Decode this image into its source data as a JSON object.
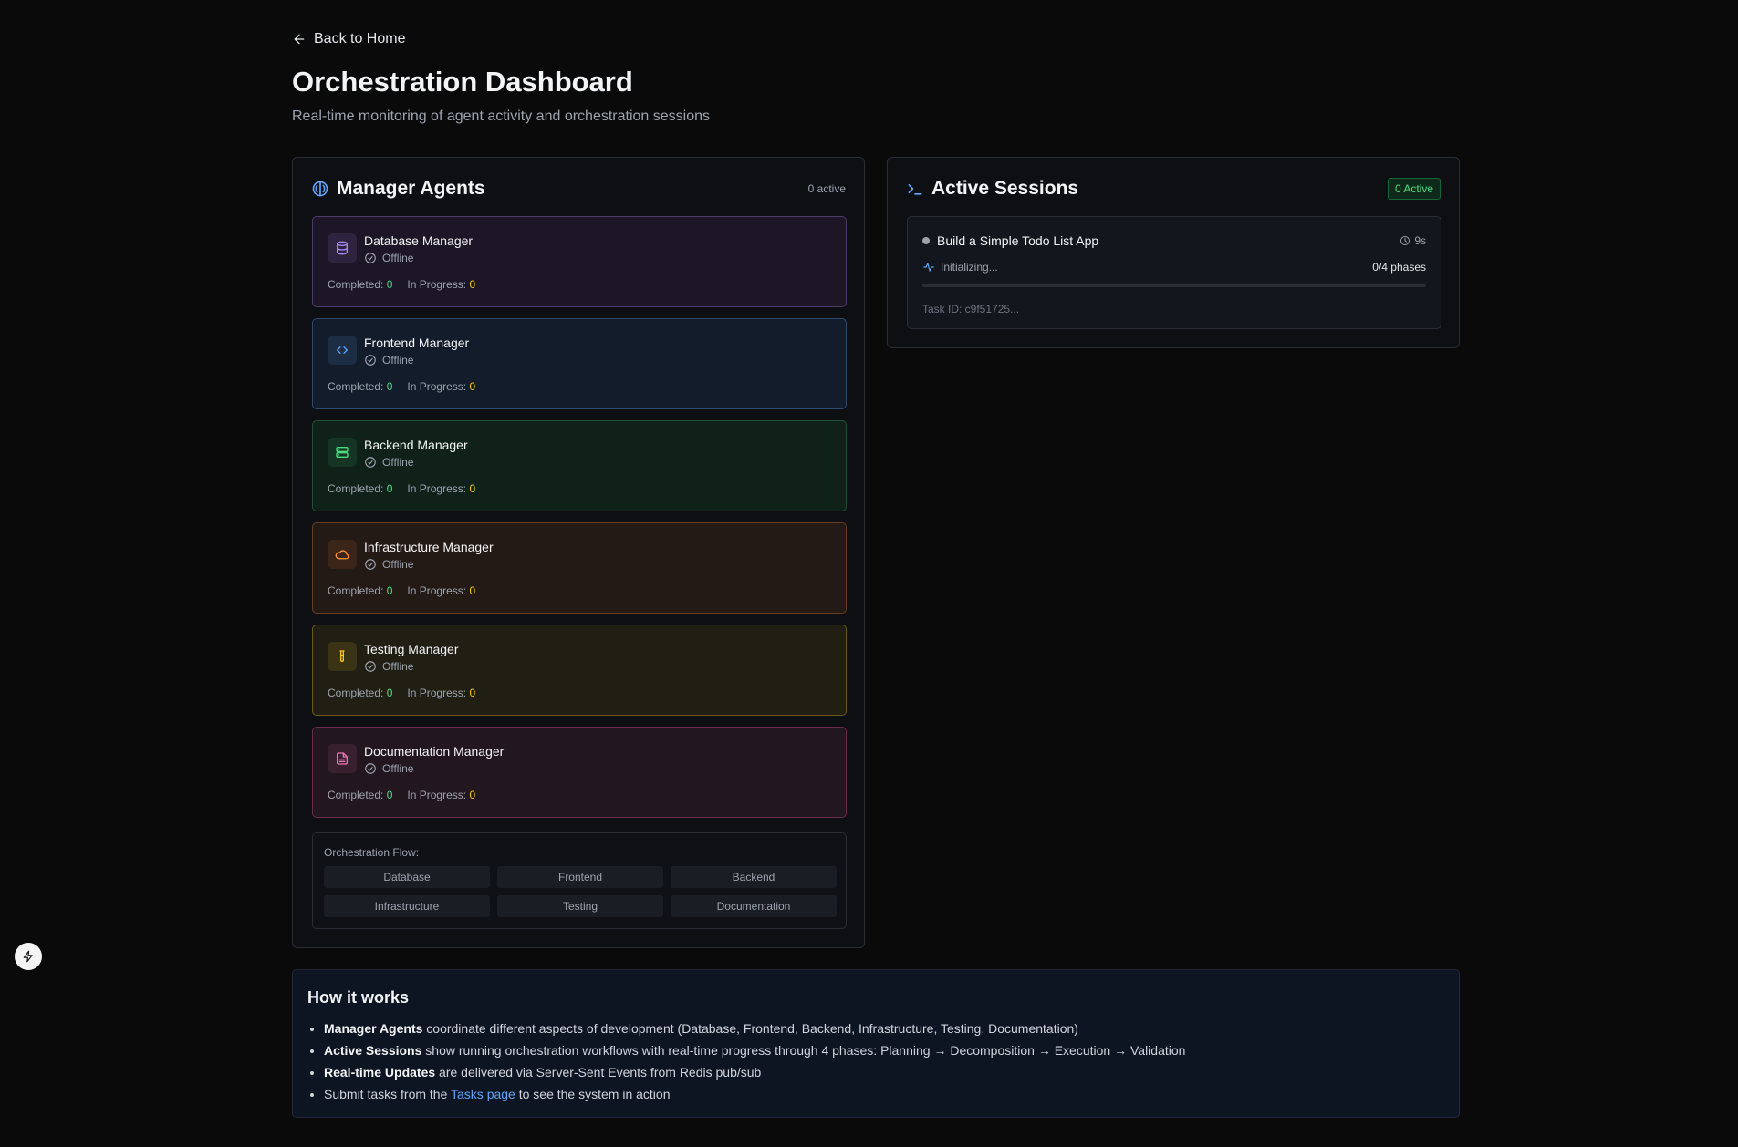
{
  "nav": {
    "back_label": "Back to Home"
  },
  "header": {
    "title": "Orchestration Dashboard",
    "subtitle": "Real-time monitoring of agent activity and orchestration sessions"
  },
  "agents_panel": {
    "title": "Manager Agents",
    "count_label": "0 active",
    "completed_label": "Completed:",
    "in_progress_label": "In Progress:",
    "agents": [
      {
        "name": "Database Manager",
        "status": "Offline",
        "completed": "0",
        "in_progress": "0",
        "icon": "database-icon",
        "color": "#a78bfa"
      },
      {
        "name": "Frontend Manager",
        "status": "Offline",
        "completed": "0",
        "in_progress": "0",
        "icon": "code-icon",
        "color": "#60a5fa"
      },
      {
        "name": "Backend Manager",
        "status": "Offline",
        "completed": "0",
        "in_progress": "0",
        "icon": "server-icon",
        "color": "#4ade80"
      },
      {
        "name": "Infrastructure Manager",
        "status": "Offline",
        "completed": "0",
        "in_progress": "0",
        "icon": "cloud-icon",
        "color": "#fb923c"
      },
      {
        "name": "Testing Manager",
        "status": "Offline",
        "completed": "0",
        "in_progress": "0",
        "icon": "test-tube-icon",
        "color": "#facc15"
      },
      {
        "name": "Documentation Manager",
        "status": "Offline",
        "completed": "0",
        "in_progress": "0",
        "icon": "file-text-icon",
        "color": "#f472b6"
      }
    ],
    "flow": {
      "label": "Orchestration Flow:",
      "steps": [
        "Database",
        "Frontend",
        "Backend",
        "Infrastructure",
        "Testing",
        "Documentation"
      ]
    }
  },
  "sessions_panel": {
    "title": "Active Sessions",
    "badge": "0 Active",
    "sessions": [
      {
        "title": "Build a Simple Todo List App",
        "elapsed": "9s",
        "state": "Initializing...",
        "phases": "0/4 phases",
        "progress": 0,
        "task_id": "Task ID: c9f51725..."
      }
    ]
  },
  "how_it_works": {
    "title": "How it works",
    "items": [
      {
        "bold": "Manager Agents",
        "text": " coordinate different aspects of development (Database, Frontend, Backend, Infrastructure, Testing, Documentation)"
      },
      {
        "bold": "Active Sessions",
        "text": " show running orchestration workflows with real-time progress through 4 phases: Planning → Decomposition → Execution → Validation"
      },
      {
        "bold": "Real-time Updates",
        "text": " are delivered via Server-Sent Events from Redis pub/sub"
      }
    ],
    "last_item": {
      "prefix": "Submit tasks from the ",
      "link": "Tasks page",
      "suffix": " to see the system in action"
    }
  },
  "colors": {
    "background": "#0a0a0b",
    "accent_blue": "#60a5fa",
    "success_green": "#4ade80",
    "warning_yellow": "#facc15"
  }
}
